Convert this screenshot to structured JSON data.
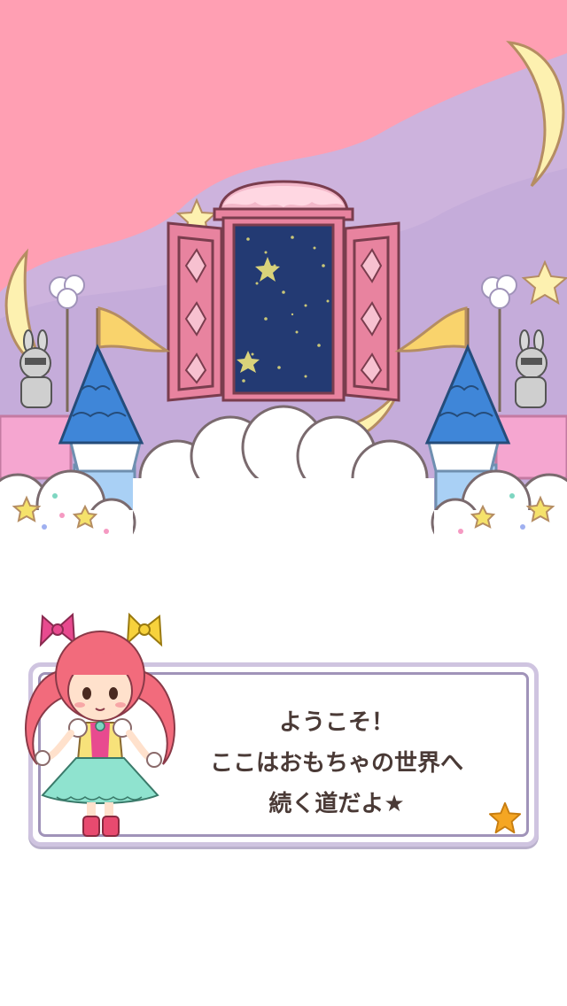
{
  "dialog": {
    "lines": [
      "ようこそ！",
      "ここはおもちゃの世界へ",
      "続く道だよ★"
    ]
  },
  "icons": {
    "next": "star-icon",
    "character": "girl-guide-icon"
  },
  "colors": {
    "sky_pink": "#ff9fb3",
    "sky_purple": "#cdb3dd",
    "moon": "#fdf1b0",
    "tower_roof": "#3f86d8",
    "door_pink": "#e8839f",
    "night_blue": "#233a73",
    "star_orange": "#f5a623",
    "dialog_border": "#a093b9"
  }
}
